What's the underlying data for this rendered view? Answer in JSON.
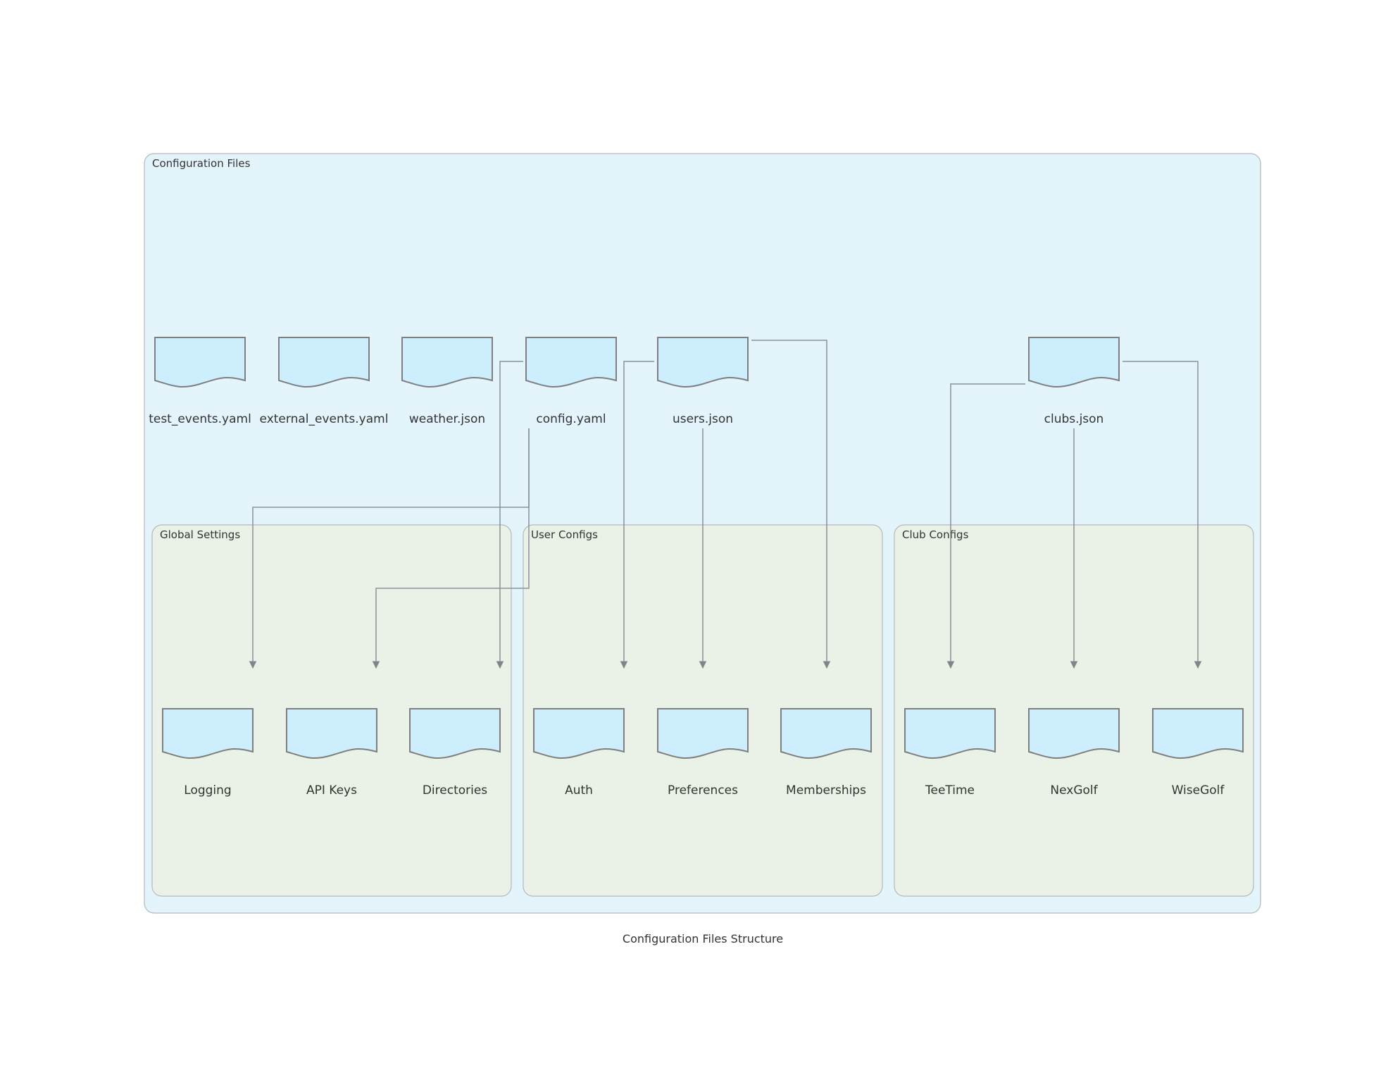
{
  "diagram": {
    "caption": "Configuration Files Structure",
    "colors": {
      "outer_cluster_fill": "#e3f4fb",
      "inner_cluster_fill": "#eaf1e6",
      "cluster_stroke": "#b3b9bf",
      "document_fill": "#cdeefc",
      "document_stroke": "#7f7f7f",
      "edge": "#8a9299",
      "text": "#333333"
    },
    "clusters": {
      "config_files": "Configuration Files",
      "global_settings": "Global Settings",
      "user_configs": "User Configs",
      "club_configs": "Club Configs"
    },
    "files": {
      "test_events": "test_events.yaml",
      "external_events": "external_events.yaml",
      "weather": "weather.json",
      "config": "config.yaml",
      "users": "users.json",
      "clubs": "clubs.json"
    },
    "settings": {
      "logging": "Logging",
      "api_keys": "API Keys",
      "directories": "Directories",
      "auth": "Auth",
      "preferences": "Preferences",
      "memberships": "Memberships",
      "teetime": "TeeTime",
      "nexgolf": "NexGolf",
      "wisegolf": "WiseGolf"
    },
    "edges": [
      {
        "from": "config.yaml",
        "to": "Logging"
      },
      {
        "from": "config.yaml",
        "to": "API Keys"
      },
      {
        "from": "config.yaml",
        "to": "Directories"
      },
      {
        "from": "users.json",
        "to": "Auth"
      },
      {
        "from": "users.json",
        "to": "Preferences"
      },
      {
        "from": "users.json",
        "to": "Memberships"
      },
      {
        "from": "clubs.json",
        "to": "TeeTime"
      },
      {
        "from": "clubs.json",
        "to": "NexGolf"
      },
      {
        "from": "clubs.json",
        "to": "WiseGolf"
      }
    ]
  }
}
